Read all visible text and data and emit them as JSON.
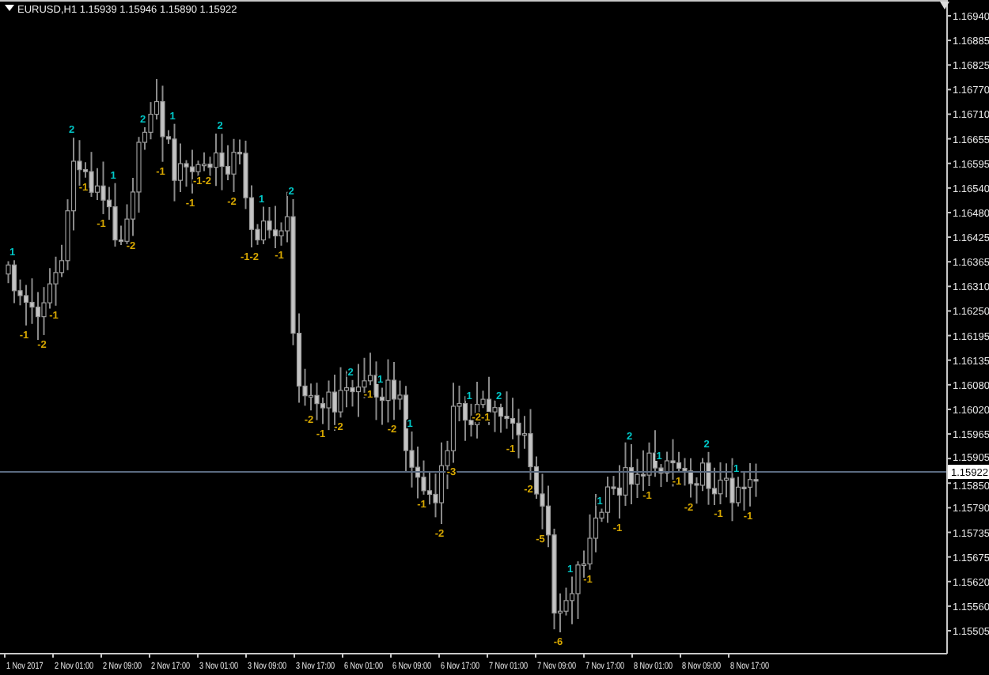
{
  "chart": {
    "title": "EURUSD,H1  1.15939 1.15946 1.15890 1.15922",
    "price_labels": [
      "1.16940",
      "1.16885",
      "1.16825",
      "1.16770",
      "1.16710",
      "1.16655",
      "1.16595",
      "1.16540",
      "1.16480",
      "1.16425",
      "1.16365",
      "1.16310",
      "1.16250",
      "1.16195",
      "1.16135",
      "1.16080",
      "1.16020",
      "1.15965",
      "1.15905",
      "1.15850",
      "1.15790",
      "1.15735",
      "1.15675",
      "1.15620",
      "1.15560",
      "1.15505"
    ],
    "current_price": "1.15922",
    "time_labels": [
      "1 Nov 2017",
      "2 Nov 01:00",
      "2 Nov 09:00",
      "2 Nov 17:00",
      "3 Nov 01:00",
      "3 Nov 09:00",
      "3 Nov 17:00",
      "6 Nov 01:00",
      "6 Nov 09:00",
      "6 Nov 17:00",
      "7 Nov 01:00",
      "7 Nov 09:00",
      "7 Nov 17:00",
      "8 Nov 01:00",
      "8 Nov 09:00",
      "8 Nov 17:00"
    ],
    "signals": [
      {
        "text": "1",
        "kind": "up"
      },
      {
        "text": "-1",
        "kind": "down"
      },
      {
        "text": "-2",
        "kind": "down"
      },
      {
        "text": "-1",
        "kind": "down"
      },
      {
        "text": "2",
        "kind": "up"
      },
      {
        "text": "-1",
        "kind": "down"
      },
      {
        "text": "-1",
        "kind": "down"
      },
      {
        "text": "1",
        "kind": "up"
      },
      {
        "text": "-2",
        "kind": "down"
      },
      {
        "text": "2",
        "kind": "up"
      },
      {
        "text": "-1",
        "kind": "down"
      },
      {
        "text": "1",
        "kind": "up"
      },
      {
        "text": "-1",
        "kind": "down"
      },
      {
        "text": "-1-2",
        "kind": "down"
      },
      {
        "text": "2",
        "kind": "up"
      },
      {
        "text": "-2",
        "kind": "down"
      },
      {
        "text": "-1-2",
        "kind": "down"
      },
      {
        "text": "1",
        "kind": "up"
      },
      {
        "text": "-1",
        "kind": "down"
      },
      {
        "text": "2",
        "kind": "up"
      },
      {
        "text": "-2",
        "kind": "down"
      },
      {
        "text": "-1",
        "kind": "down"
      },
      {
        "text": "-2",
        "kind": "down"
      },
      {
        "text": "2",
        "kind": "up"
      },
      {
        "text": "-1",
        "kind": "down"
      },
      {
        "text": "1",
        "kind": "up"
      },
      {
        "text": "-2",
        "kind": "down"
      },
      {
        "text": "1",
        "kind": "up"
      },
      {
        "text": "-1",
        "kind": "down"
      },
      {
        "text": "-2",
        "kind": "down"
      },
      {
        "text": "-3",
        "kind": "down"
      },
      {
        "text": "1",
        "kind": "up"
      },
      {
        "text": "-2-1",
        "kind": "down"
      },
      {
        "text": "2",
        "kind": "up"
      },
      {
        "text": "-1",
        "kind": "down"
      },
      {
        "text": "-2",
        "kind": "down"
      },
      {
        "text": "-5",
        "kind": "down"
      },
      {
        "text": "-6",
        "kind": "down"
      },
      {
        "text": "1",
        "kind": "up"
      },
      {
        "text": "-1",
        "kind": "down"
      },
      {
        "text": "1",
        "kind": "up"
      },
      {
        "text": "-1",
        "kind": "down"
      },
      {
        "text": "2",
        "kind": "up"
      },
      {
        "text": "-1",
        "kind": "down"
      },
      {
        "text": "1",
        "kind": "up"
      },
      {
        "text": "-1",
        "kind": "down"
      },
      {
        "text": "-2",
        "kind": "down"
      },
      {
        "text": "2",
        "kind": "up"
      },
      {
        "text": "-1",
        "kind": "down"
      },
      {
        "text": "1",
        "kind": "up"
      },
      {
        "text": "-1",
        "kind": "down"
      }
    ]
  }
}
